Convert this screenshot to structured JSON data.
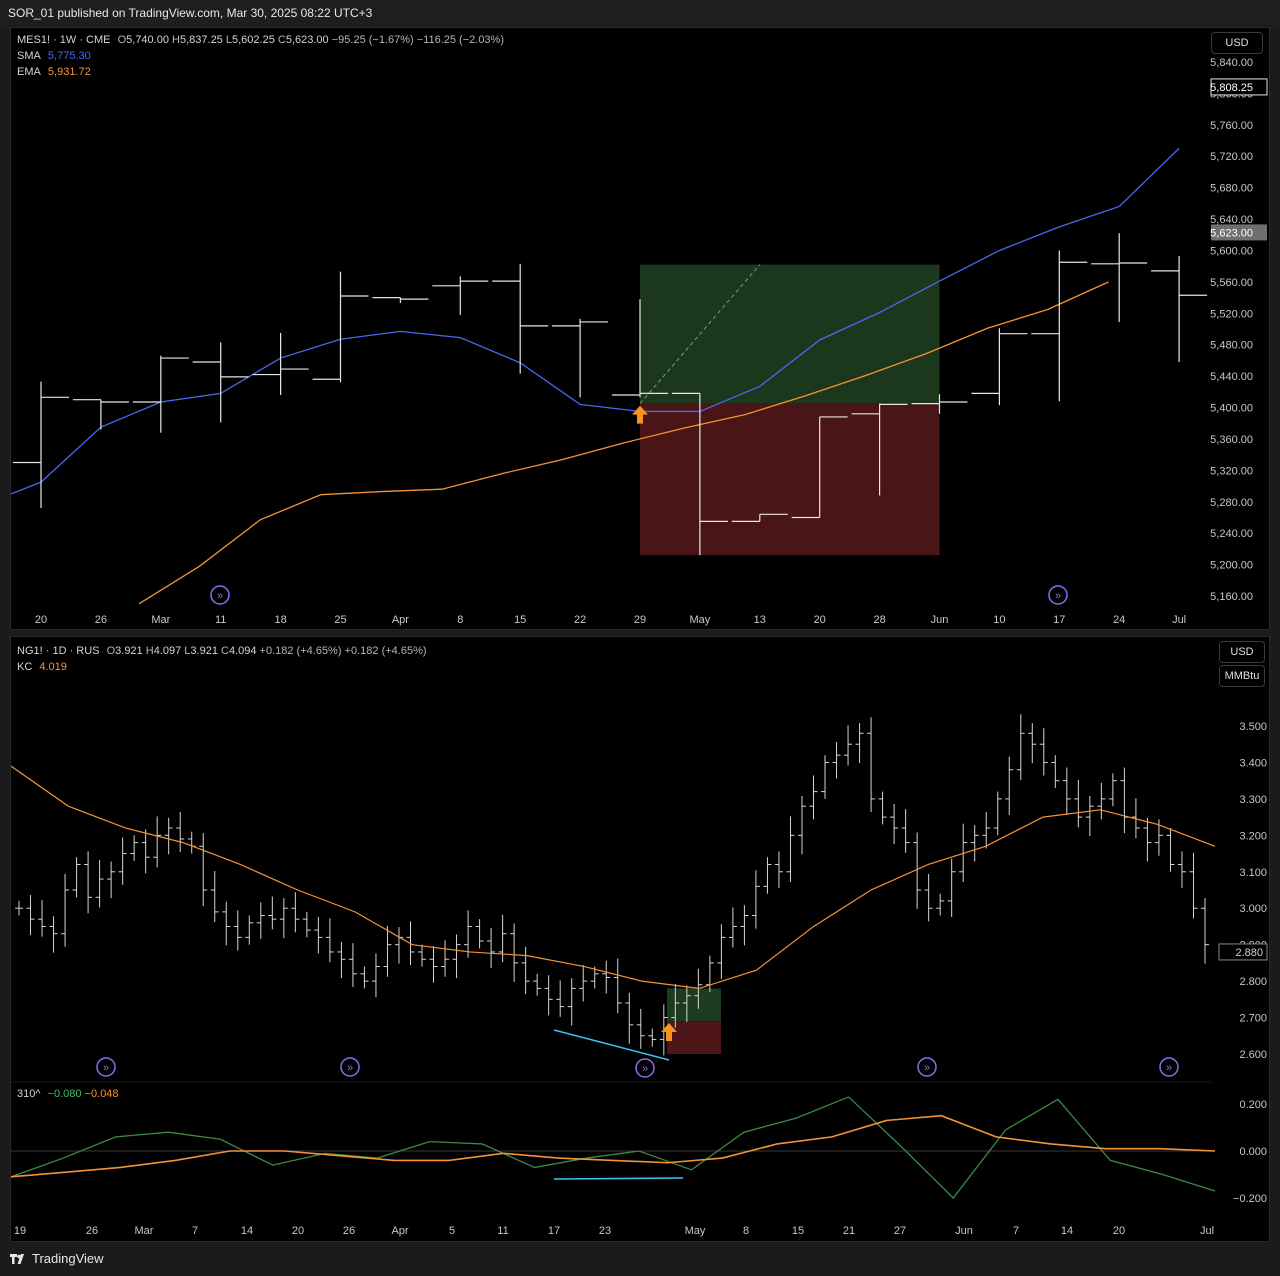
{
  "header": {
    "published": "SOR_01 published on TradingView.com, Mar 30, 2025 08:22 UTC+3"
  },
  "footer": {
    "brand": "TradingView"
  },
  "top": {
    "symbol_line": "MES1! · 1W · CME",
    "ohlc": {
      "o": "5,740.00",
      "h": "5,837.25",
      "l": "5,602.25",
      "c": "5,623.00",
      "chg": "−95.25 (−1.67%)",
      "chg2": "−116.25 (−2.03%)"
    },
    "sma_label": "SMA",
    "sma_value": "5,775.30",
    "ema_label": "EMA",
    "ema_value": "5,931.72",
    "currency_button": "USD",
    "price_badges": {
      "high": "5,808.25",
      "current": "5,623.00"
    },
    "y_ticks": [
      "5,840.00",
      "5,800.00",
      "5,760.00",
      "5,720.00",
      "5,680.00",
      "5,640.00",
      "5,600.00",
      "5,560.00",
      "5,520.00",
      "5,480.00",
      "5,440.00",
      "5,400.00",
      "5,360.00",
      "5,320.00",
      "5,280.00",
      "5,240.00",
      "5,200.00",
      "5,160.00"
    ],
    "x_ticks": [
      "20",
      "26",
      "Mar",
      "11",
      "18",
      "25",
      "Apr",
      "8",
      "15",
      "22",
      "29",
      "May",
      "13",
      "20",
      "28",
      "Jun",
      "10",
      "17",
      "24",
      "Jul"
    ]
  },
  "bottom": {
    "symbol_line": "NG1! · 1D · RUS",
    "ohlc": {
      "o": "3.921",
      "h": "4.097",
      "l": "3.921",
      "c": "4.094",
      "chg": "+0.182 (+4.65%)",
      "chg2": "+0.182 (+4.65%)"
    },
    "kc_label": "KC",
    "kc_value": "4.019",
    "currency_button": "USD",
    "unit_button": "MMBtu",
    "price_badges": {
      "current": "2.880"
    },
    "y_ticks": [
      "3.500",
      "3.400",
      "3.300",
      "3.200",
      "3.100",
      "3.000",
      "2.900",
      "2.800",
      "2.700",
      "2.600"
    ],
    "x_ticks": [
      "19",
      "26",
      "Mar",
      "7",
      "14",
      "20",
      "26",
      "Apr",
      "5",
      "11",
      "17",
      "23",
      "May",
      "8",
      "15",
      "21",
      "27",
      "Jun",
      "7",
      "14",
      "20",
      "Jul"
    ],
    "osc": {
      "label": "310^",
      "value1": "−0.080",
      "value2": "−0.048",
      "y_ticks": [
        "0.200",
        "0.000",
        "−0.200"
      ]
    }
  },
  "colors": {
    "sma": "#4a68f0",
    "ema": "#f39336",
    "kc": "#f39336",
    "osc_fast": "#3c8a46",
    "osc_slow": "#f39336",
    "divergence": "#3ec6ee",
    "arrow": "#f7931e",
    "profit_zone": "#1c3b1f",
    "loss_zone": "#4e1618"
  },
  "chart_data": [
    {
      "type": "ohlc",
      "symbol": "MES1!",
      "timeframe": "1W",
      "y_range": [
        5140,
        5860
      ],
      "x": [
        "20",
        "26",
        "Mar",
        "11",
        "18",
        "25",
        "Apr",
        "8",
        "15",
        "22",
        "29",
        "May",
        "13",
        "20",
        "28",
        "Jun",
        "10",
        "17",
        "24",
        "Jul"
      ],
      "bars": [
        {
          "o": 5330,
          "h": 5433,
          "l": 5272,
          "c": 5413
        },
        {
          "o": 5410,
          "h": 5410,
          "l": 5372,
          "c": 5407
        },
        {
          "o": 5407,
          "h": 5466,
          "l": 5368,
          "c": 5463
        },
        {
          "o": 5458,
          "h": 5483,
          "l": 5381,
          "c": 5439
        },
        {
          "o": 5442,
          "h": 5495,
          "l": 5416,
          "c": 5449
        },
        {
          "o": 5436,
          "h": 5573,
          "l": 5432,
          "c": 5542
        },
        {
          "o": 5540,
          "h": 5540,
          "l": 5533,
          "c": 5538
        },
        {
          "o": 5555,
          "h": 5567,
          "l": 5518,
          "c": 5561
        },
        {
          "o": 5561,
          "h": 5583,
          "l": 5443,
          "c": 5504
        },
        {
          "o": 5504,
          "h": 5513,
          "l": 5413,
          "c": 5509
        },
        {
          "o": 5416,
          "h": 5538,
          "l": 5413,
          "c": 5418
        },
        {
          "o": 5418,
          "h": 5418,
          "l": 5212,
          "c": 5255
        },
        {
          "o": 5255,
          "h": 5263,
          "l": 5263,
          "c": 5264
        },
        {
          "o": 5260,
          "h": 5388,
          "l": 5262,
          "c": 5388
        },
        {
          "o": 5392,
          "h": 5405,
          "l": 5288,
          "c": 5404
        },
        {
          "o": 5405,
          "h": 5417,
          "l": 5392,
          "c": 5407
        },
        {
          "o": 5418,
          "h": 5501,
          "l": 5403,
          "c": 5494
        },
        {
          "o": 5494,
          "h": 5600,
          "l": 5408,
          "c": 5585
        },
        {
          "o": 5583,
          "h": 5622,
          "l": 5509,
          "c": 5584
        },
        {
          "o": 5574,
          "h": 5593,
          "l": 5458,
          "c": 5543
        }
      ],
      "series": [
        {
          "name": "SMA",
          "values": [
            5305,
            5375,
            5407,
            5418,
            5463,
            5487,
            5497,
            5489,
            5457,
            5404,
            5395,
            5395,
            5427,
            5486,
            5521,
            5561,
            5600,
            5630,
            5656,
            5730
          ]
        },
        {
          "name": "EMA",
          "values": [
            5150,
            5198,
            5257,
            5289,
            5293,
            5296,
            5316,
            5334,
            5355,
            5374,
            5391,
            5415,
            5441,
            5469,
            5501,
            5525,
            5560
          ]
        }
      ]
    },
    {
      "type": "ohlc",
      "symbol": "NG1!",
      "timeframe": "1D",
      "y_range": [
        2.55,
        3.62
      ],
      "x": [
        "19",
        "26",
        "Mar",
        "7",
        "14",
        "20",
        "26",
        "Apr",
        "5",
        "11",
        "17",
        "23",
        "May",
        "8",
        "15",
        "21",
        "27",
        "Jun",
        "7",
        "14",
        "20",
        "Jul"
      ],
      "series": [
        {
          "name": "KC",
          "values": [
            3.39,
            3.28,
            3.22,
            3.18,
            3.12,
            3.05,
            2.99,
            2.9,
            2.88,
            2.87,
            2.84,
            2.8,
            2.78,
            2.83,
            2.95,
            3.05,
            3.12,
            3.17,
            3.25,
            3.27,
            3.23,
            3.17
          ]
        }
      ]
    },
    {
      "type": "line",
      "name": "310^",
      "y_range": [
        -0.22,
        0.25
      ],
      "series": [
        {
          "name": "fast",
          "values": [
            -0.11,
            -0.03,
            0.06,
            0.08,
            0.05,
            -0.06,
            -0.01,
            -0.03,
            0.04,
            0.03,
            -0.07,
            -0.03,
            0.0,
            -0.08,
            0.08,
            0.14,
            0.23,
            0.02,
            -0.2,
            0.09,
            0.22,
            -0.04,
            -0.1,
            -0.17
          ]
        },
        {
          "name": "slow",
          "values": [
            -0.11,
            -0.09,
            -0.07,
            -0.04,
            0.0,
            0.0,
            -0.02,
            -0.04,
            -0.04,
            -0.01,
            -0.03,
            -0.04,
            -0.05,
            -0.03,
            0.03,
            0.06,
            0.13,
            0.15,
            0.06,
            0.03,
            0.01,
            0.01,
            0.0
          ]
        }
      ]
    }
  ]
}
